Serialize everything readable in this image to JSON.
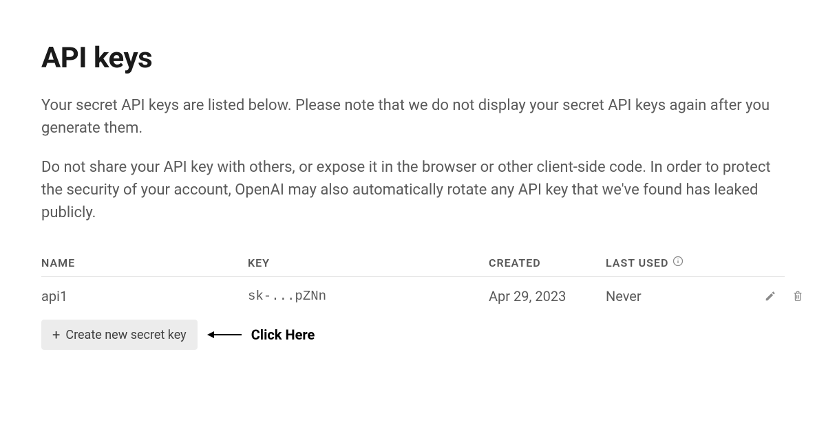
{
  "page": {
    "title": "API keys",
    "description1": "Your secret API keys are listed below. Please note that we do not display your secret API keys again after you generate them.",
    "description2": "Do not share your API key with others, or expose it in the browser or other client-side code. In order to protect the security of your account, OpenAI may also automatically rotate any API key that we've found has leaked publicly."
  },
  "table": {
    "headers": {
      "name": "NAME",
      "key": "KEY",
      "created": "CREATED",
      "last_used": "LAST USED"
    },
    "rows": [
      {
        "name": "api1",
        "key": "sk-...pZNn",
        "created": "Apr 29, 2023",
        "last_used": "Never"
      }
    ]
  },
  "create_button": {
    "plus": "+",
    "label": "Create new secret key"
  },
  "annotation": {
    "text": "Click Here"
  }
}
